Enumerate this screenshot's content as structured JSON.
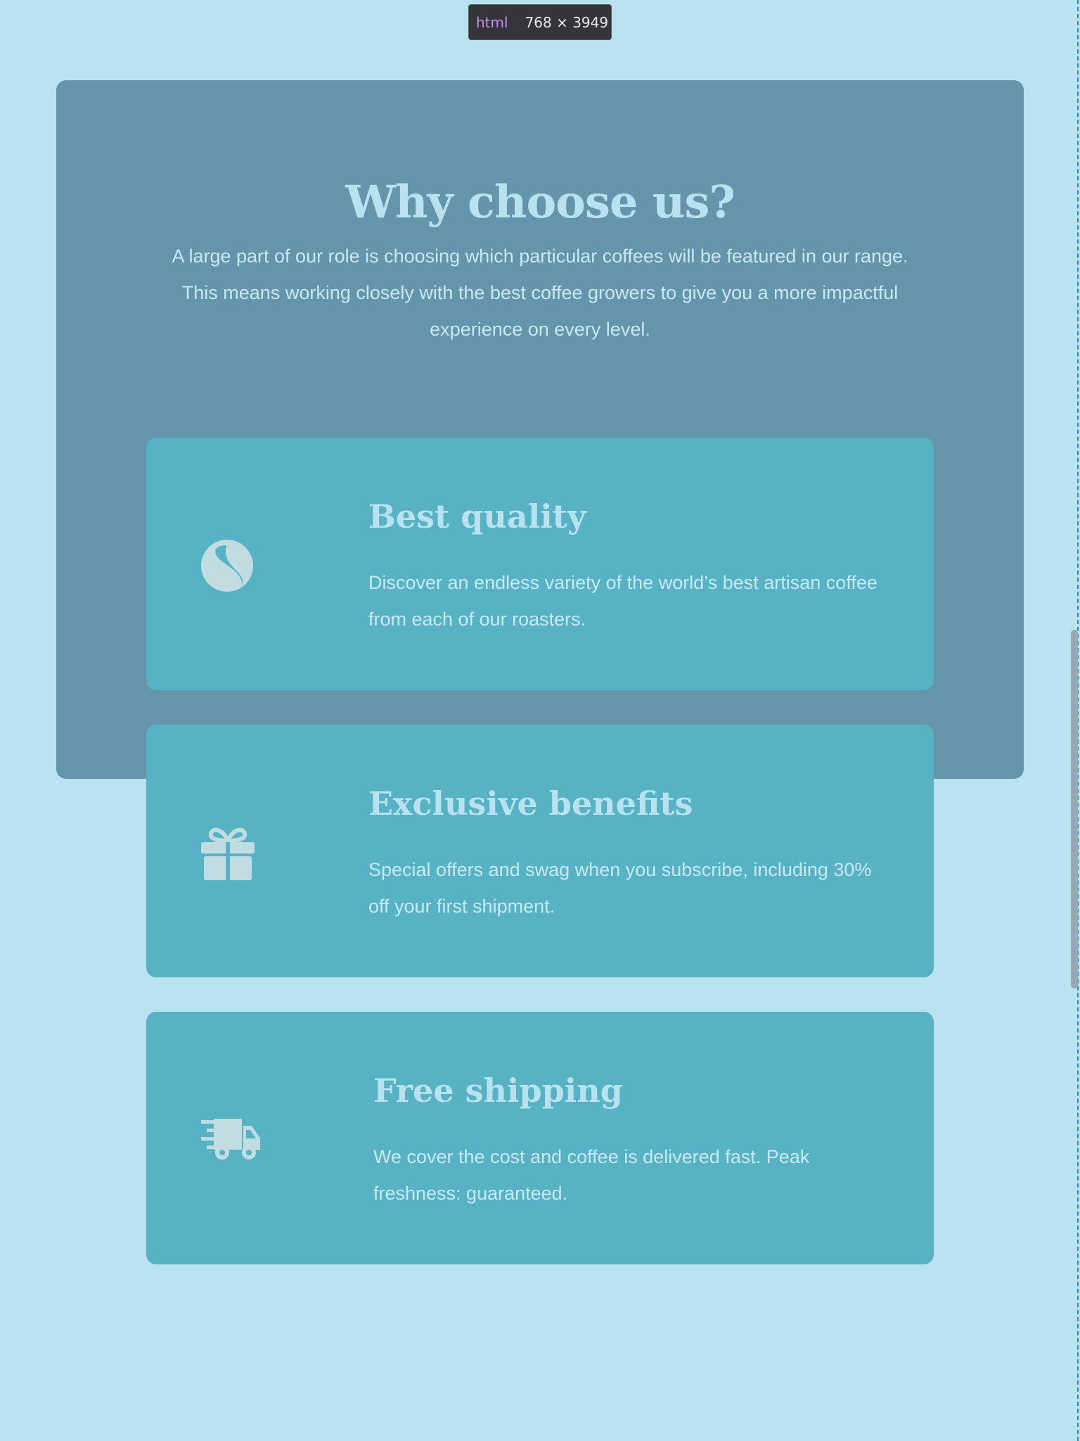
{
  "devtools": {
    "tag": "html",
    "dimensions": "768 × 3949"
  },
  "section": {
    "title": "Why choose us?",
    "lead": "A large part of our role is choosing which particular coffees will be featured in our range. This means working closely with the best coffee growers to give you a more impactful experience on every level."
  },
  "features": [
    {
      "icon": "coffee-bean-icon",
      "title": "Best quality",
      "description": "Discover an endless variety of the world’s best artisan coffee from each of our roasters."
    },
    {
      "icon": "gift-icon",
      "title": "Exclusive benefits",
      "description": "Special offers and swag when you subscribe, including 30% off your first shipment."
    },
    {
      "icon": "delivery-truck-icon",
      "title": "Free shipping",
      "description": "We cover the cost and coffee is delivered fast. Peak freshness: guaranteed."
    }
  ],
  "colors": {
    "page_background": "#bae3f2",
    "panel_background": "#6595ab",
    "card_background": "#57b3c3",
    "heading_text": "#b8e2f0",
    "icon_fill": "#c1dde2"
  }
}
